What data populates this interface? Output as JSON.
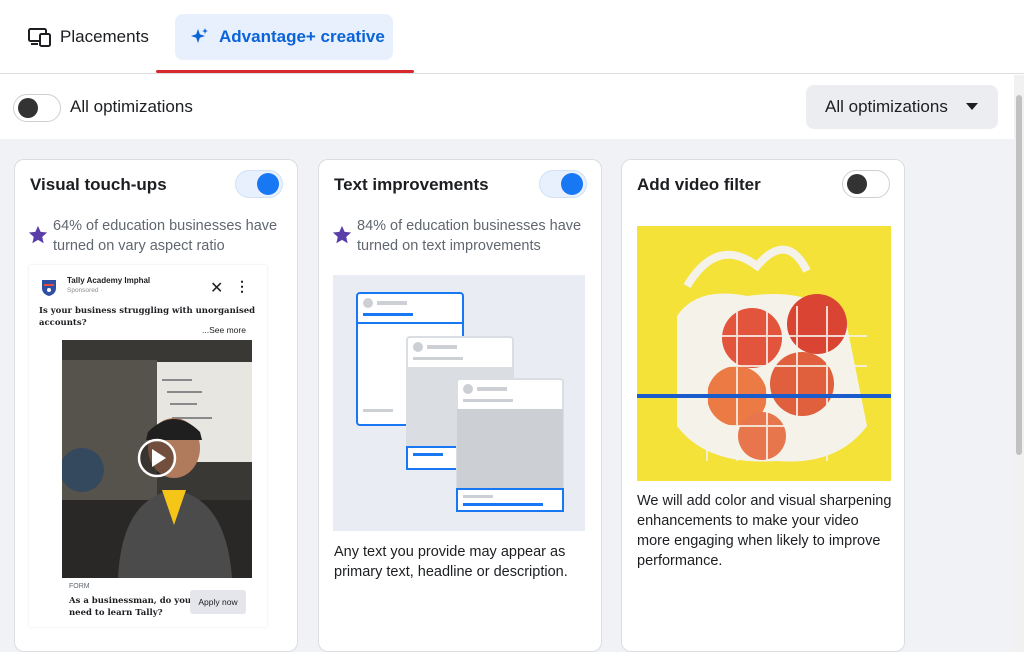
{
  "tabs": {
    "placements_label": "Placements",
    "advantage_label": "Advantage+ creative"
  },
  "toolbar": {
    "toggle_label": "All optimizations",
    "toggle_state": "off",
    "dropdown_value": "All optimizations"
  },
  "cards": [
    {
      "title": "Visual touch-ups",
      "enabled": true,
      "stat": "64% of education businesses have turned on vary aspect ratio",
      "ad_preview": {
        "page_name": "Tally Academy Imphal",
        "sponsored": "Sponsored · ",
        "primary_text": "Is your business struggling with unorganised accounts?",
        "see_more": "...See more",
        "form_label": "FORM",
        "headline": "As a businessman, do you need to learn Tally?",
        "cta": "Apply now"
      }
    },
    {
      "title": "Text improvements",
      "enabled": true,
      "stat": "84% of education businesses have turned on text improvements",
      "description": "Any text you provide may appear as primary text, headline or description."
    },
    {
      "title": "Add video filter",
      "enabled": false,
      "description": "We will add color and visual sharpening enhancements to make your video more engaging when likely to improve performance."
    }
  ],
  "colors": {
    "accent": "#1877f2",
    "tab_active_bg": "#e7f0fc",
    "tab_active_text": "#0a63d8",
    "stat_star": "#5b3fa8",
    "underline": "#d8282b"
  },
  "icons": {
    "placements": "devices-icon",
    "advantage": "sparkle-icon",
    "stat": "star-icon"
  }
}
